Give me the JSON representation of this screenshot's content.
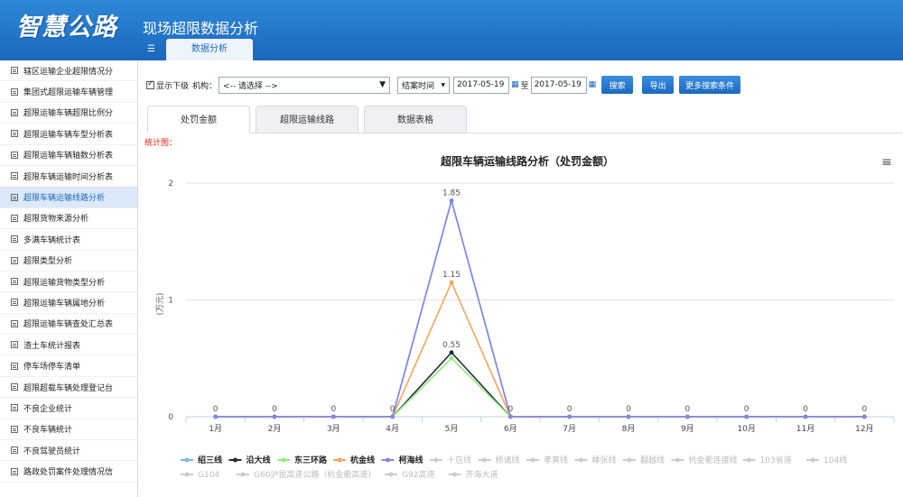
{
  "header": {
    "logo_text": "智慧公路",
    "app_title": "现场超限数据分析",
    "nav_icon": "list-icon",
    "nav_tab": "数据分析"
  },
  "sidebar": {
    "items": [
      {
        "label": "辖区运输企业超限情况分"
      },
      {
        "label": "集团式超限运输车辆管理"
      },
      {
        "label": "超限运输车辆超限比例分"
      },
      {
        "label": "超限运输车辆车型分析表"
      },
      {
        "label": "超限运输车辆轴数分析表"
      },
      {
        "label": "超限车辆运输时间分析表"
      },
      {
        "label": "超限车辆运输线路分析"
      },
      {
        "label": "超限货物来源分析"
      },
      {
        "label": "多满车辆统计表"
      },
      {
        "label": "超限类型分析"
      },
      {
        "label": "超限运输货物类型分析"
      },
      {
        "label": "超限运输车辆属地分析"
      },
      {
        "label": "超限运输车辆查处汇总表"
      },
      {
        "label": "渣土车统计报表"
      },
      {
        "label": "停车场停车清单"
      },
      {
        "label": "超限超载车辆处理登记台"
      },
      {
        "label": "不良企业统计"
      },
      {
        "label": "不良车辆统计"
      },
      {
        "label": "不良驾驶员统计"
      },
      {
        "label": "路政处罚案件处理情况信"
      }
    ],
    "active_index": 6
  },
  "toolbar": {
    "show_sub_label": "显示下级",
    "org_label": "机构：",
    "org_value": "<-- 请选择 -->",
    "time_type": "结案时间",
    "date_from": "2017-05-19",
    "to_label": "至",
    "date_to": "2017-05-19",
    "search_btn": "搜索",
    "export_btn": "导出",
    "more_btn": "更多搜索条件"
  },
  "tabs": [
    "处罚金额",
    "超限运输线路",
    "数据表格"
  ],
  "stat_label": "统计图：",
  "colors": {
    "header_top": "#2f88d8",
    "header_bottom": "#1a67bd",
    "accent": "#1b69c0",
    "alert": "#e21"
  },
  "chart_data": {
    "type": "line",
    "title": "超限车辆运输线路分析（处罚金额）",
    "ylabel": "(万元)",
    "xlabel": "",
    "ylim": [
      0,
      2
    ],
    "y_ticks": [
      0,
      1,
      2
    ],
    "grid": "horizontal",
    "legend_position": "bottom",
    "menu_icon": "hamburger-icon",
    "categories": [
      "1月",
      "2月",
      "3月",
      "4月",
      "5月",
      "6月",
      "7月",
      "8月",
      "9月",
      "10月",
      "11月",
      "12月"
    ],
    "point_labels": [
      "0",
      "0",
      "0",
      "0",
      "1.85",
      "0",
      "0",
      "0",
      "0",
      "0",
      "0",
      "0"
    ],
    "series": [
      {
        "name": "绍三线",
        "color": "#7cb5ec",
        "visible": true,
        "values": [
          0,
          0,
          0,
          0,
          1.85,
          0,
          0,
          0,
          0,
          0,
          0,
          0
        ]
      },
      {
        "name": "沿大线",
        "color": "#1f2b38",
        "visible": true,
        "values": [
          0,
          0,
          0,
          0,
          0.55,
          0,
          0,
          0,
          0,
          0,
          0,
          0
        ]
      },
      {
        "name": "东三环路",
        "color": "#90ed7d",
        "visible": true,
        "values": [
          0,
          0,
          0,
          0,
          0.5,
          0,
          0,
          0,
          0,
          0,
          0,
          0
        ]
      },
      {
        "name": "杭金线",
        "color": "#f7a35c",
        "visible": true,
        "values": [
          0,
          0,
          0,
          0,
          1.15,
          0,
          0,
          0,
          0,
          0,
          0,
          0
        ]
      },
      {
        "name": "柯海线",
        "color": "#8085e9",
        "visible": true,
        "values": [
          0,
          0,
          0,
          0,
          1.85,
          0,
          0,
          0,
          0,
          0,
          0,
          0
        ]
      },
      {
        "name": "十店线",
        "color": "#cccccc",
        "visible": false,
        "values": [
          0,
          0,
          0,
          0,
          0,
          0,
          0,
          0,
          0,
          0,
          0,
          0
        ]
      },
      {
        "name": "杨诸线",
        "color": "#cccccc",
        "visible": false,
        "values": [
          0,
          0,
          0,
          0,
          0,
          0,
          0,
          0,
          0,
          0,
          0,
          0
        ]
      },
      {
        "name": "孝黄线",
        "color": "#cccccc",
        "visible": false,
        "values": [
          0,
          0,
          0,
          0,
          0,
          0,
          0,
          0,
          0,
          0,
          0,
          0
        ]
      },
      {
        "name": "嵊张线",
        "color": "#cccccc",
        "visible": false,
        "values": [
          0,
          0,
          0,
          0,
          0,
          0,
          0,
          0,
          0,
          0,
          0,
          0
        ]
      },
      {
        "name": "翻越线",
        "color": "#cccccc",
        "visible": false,
        "values": [
          0,
          0,
          0,
          0,
          0,
          0,
          0,
          0,
          0,
          0,
          0,
          0
        ]
      },
      {
        "name": "杭金衢连接线",
        "color": "#cccccc",
        "visible": false,
        "values": [
          0,
          0,
          0,
          0,
          0,
          0,
          0,
          0,
          0,
          0,
          0,
          0
        ]
      },
      {
        "name": "103省道",
        "color": "#cccccc",
        "visible": false,
        "values": [
          0,
          0,
          0,
          0,
          0,
          0,
          0,
          0,
          0,
          0,
          0,
          0
        ]
      },
      {
        "name": "104线",
        "color": "#cccccc",
        "visible": false,
        "values": [
          0,
          0,
          0,
          0,
          0,
          0,
          0,
          0,
          0,
          0,
          0,
          0
        ]
      },
      {
        "name": "G104",
        "color": "#cccccc",
        "visible": false,
        "values": [
          0,
          0,
          0,
          0,
          0,
          0,
          0,
          0,
          0,
          0,
          0,
          0
        ]
      },
      {
        "name": "G60沪昆高速公路（杭金衢高速）",
        "color": "#cccccc",
        "visible": false,
        "values": [
          0,
          0,
          0,
          0,
          0,
          0,
          0,
          0,
          0,
          0,
          0,
          0
        ]
      },
      {
        "name": "G92高速",
        "color": "#cccccc",
        "visible": false,
        "values": [
          0,
          0,
          0,
          0,
          0,
          0,
          0,
          0,
          0,
          0,
          0,
          0
        ]
      },
      {
        "name": "齐海大道",
        "color": "#cccccc",
        "visible": false,
        "values": [
          0,
          0,
          0,
          0,
          0,
          0,
          0,
          0,
          0,
          0,
          0,
          0
        ]
      }
    ]
  }
}
